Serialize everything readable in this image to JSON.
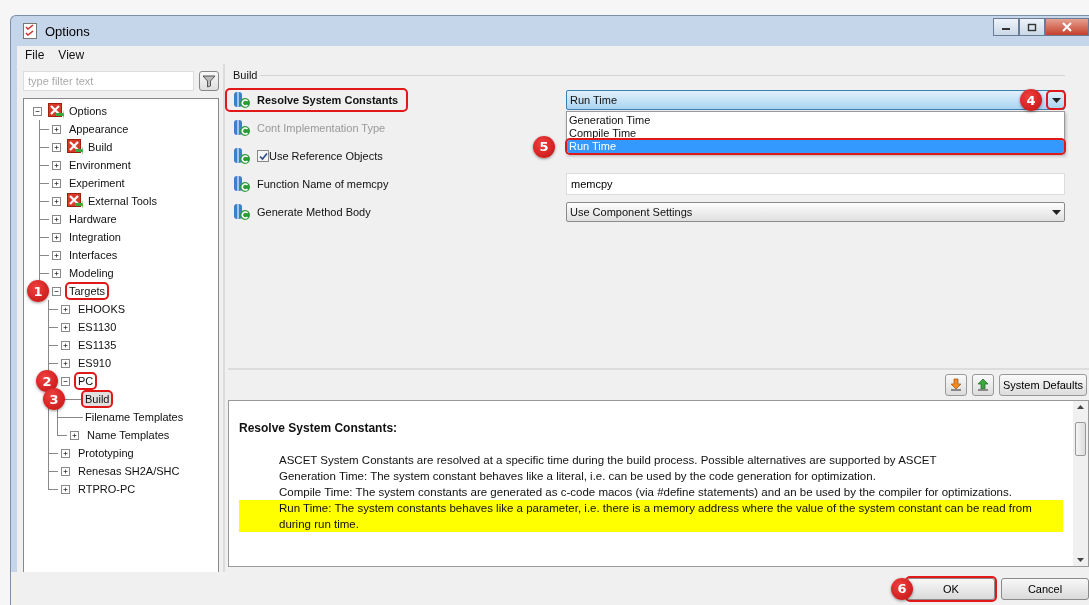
{
  "window": {
    "title": "Options"
  },
  "menu": [
    "File",
    "View"
  ],
  "filter": {
    "placeholder": "type filter text"
  },
  "tree": {
    "label": "Options",
    "kind": "branch",
    "expanded": true,
    "has_icon": true,
    "selected": false,
    "children": [
      {
        "label": "Appearance",
        "kind": "branch",
        "expanded": false,
        "selected": false
      },
      {
        "label": "Build",
        "kind": "branch",
        "expanded": false,
        "has_icon": true,
        "selected": false
      },
      {
        "label": "Environment",
        "kind": "branch",
        "expanded": false,
        "selected": false
      },
      {
        "label": "Experiment",
        "kind": "branch",
        "expanded": false,
        "selected": false
      },
      {
        "label": "External Tools",
        "kind": "branch",
        "expanded": false,
        "has_icon": true,
        "selected": false
      },
      {
        "label": "Hardware",
        "kind": "branch",
        "expanded": false,
        "selected": false
      },
      {
        "label": "Integration",
        "kind": "branch",
        "expanded": false,
        "selected": false
      },
      {
        "label": "Interfaces",
        "kind": "branch",
        "expanded": false,
        "selected": false
      },
      {
        "label": "Modeling",
        "kind": "branch",
        "expanded": false,
        "selected": false
      },
      {
        "label": "Targets",
        "kind": "branch",
        "expanded": true,
        "selected": false,
        "callout": "1",
        "children": [
          {
            "label": "EHOOKS",
            "kind": "branch",
            "expanded": false,
            "selected": false
          },
          {
            "label": "ES1130",
            "kind": "branch",
            "expanded": false,
            "selected": false
          },
          {
            "label": "ES1135",
            "kind": "branch",
            "expanded": false,
            "selected": false
          },
          {
            "label": "ES910",
            "kind": "branch",
            "expanded": false,
            "selected": false
          },
          {
            "label": "PC",
            "kind": "branch",
            "expanded": true,
            "selected": false,
            "callout": "2",
            "children": [
              {
                "label": "Build",
                "kind": "leaf",
                "selected": true,
                "callout": "3"
              },
              {
                "label": "Filename Templates",
                "kind": "leaf",
                "selected": false
              },
              {
                "label": "Name Templates",
                "kind": "branch",
                "expanded": false,
                "selected": false
              }
            ]
          },
          {
            "label": "Prototyping",
            "kind": "branch",
            "expanded": false,
            "selected": false
          },
          {
            "label": "Renesas SH2A/SHC",
            "kind": "branch",
            "expanded": false,
            "selected": false
          },
          {
            "label": "RTPRO-PC",
            "kind": "branch",
            "expanded": false,
            "selected": false
          }
        ]
      }
    ]
  },
  "group_title": "Build",
  "settings": [
    {
      "kind": "combo",
      "label": "Resolve System Constants",
      "selected": true,
      "disabled": false,
      "value": "Run Time",
      "open": true,
      "button_callout": "4",
      "options": [
        {
          "label": "Generation Time",
          "selected": false
        },
        {
          "label": "Compile Time",
          "selected": false
        },
        {
          "label": "Run Time",
          "selected": true,
          "callout": "5"
        }
      ]
    },
    {
      "kind": "none",
      "label": "Cont Implementation Type",
      "selected": false,
      "disabled": true
    },
    {
      "kind": "checkbox",
      "label": "Use Reference Objects",
      "selected": false,
      "disabled": false,
      "checked": true
    },
    {
      "kind": "text",
      "label": "Function Name of memcpy",
      "selected": false,
      "disabled": false,
      "value": "memcpy"
    },
    {
      "kind": "combo",
      "label": "Generate Method Body",
      "selected": false,
      "disabled": false,
      "value": "Use Component Settings",
      "open": false
    }
  ],
  "toolbar": {
    "defaults_button": "System Defaults"
  },
  "help": {
    "title": "Resolve System Constants:",
    "paragraphs": [
      {
        "text": "ASCET System Constants are resolved at a specific time during the build process. Possible alternatives are supported by ASCET",
        "highlighted": false
      },
      {
        "text": "Generation Time: The system constant behaves like a literal, i.e. can be used by the code generation for optimization.",
        "highlighted": false
      },
      {
        "text": "Compile Time: The system constants are generated as c-code macos (via #define statements) and an be used by the compiler for optimizations.",
        "highlighted": false
      },
      {
        "text": "Run Time: The system constants behaves like a parameter, i.e. there is a memory address where the value of the system constant can be read from during run time.",
        "highlighted": true
      }
    ]
  },
  "buttons": [
    {
      "label": "OK",
      "callout": "6"
    },
    {
      "label": "Cancel"
    }
  ]
}
